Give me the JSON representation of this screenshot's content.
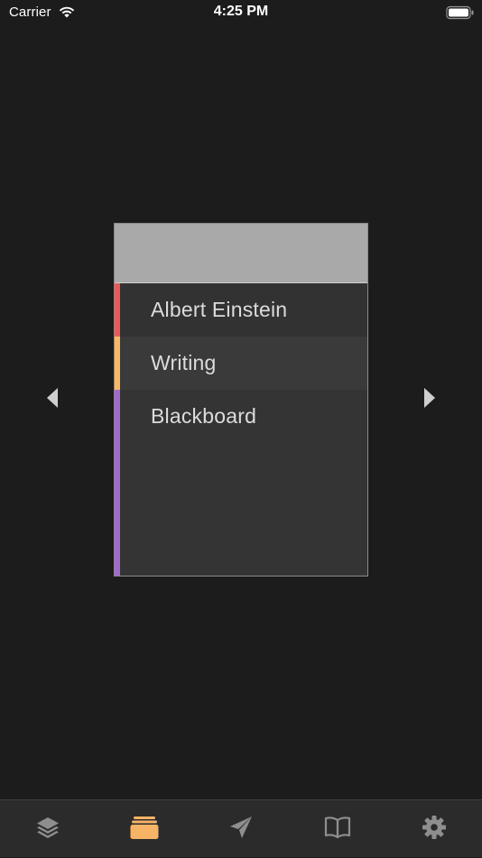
{
  "status_bar": {
    "carrier": "Carrier",
    "time": "4:25 PM"
  },
  "colors": {
    "background": "#1c1c1c",
    "tab_active": "#f7b366",
    "tab_inactive": "#8e8e8e",
    "stripe_red": "#e65a5a",
    "stripe_orange": "#f5b866",
    "stripe_purple": "#a06cc8"
  },
  "navigation": {
    "prev_icon": "triangle-left-icon",
    "next_icon": "triangle-right-icon"
  },
  "card": {
    "items": [
      {
        "label": "Albert Einstein",
        "stripe_color": "#e65a5a"
      },
      {
        "label": "Writing",
        "stripe_color": "#f5b866"
      },
      {
        "label": "Blackboard",
        "stripe_color": "#a06cc8"
      }
    ]
  },
  "tab_bar": {
    "tabs": [
      {
        "icon": "layers-icon",
        "active": false
      },
      {
        "icon": "folder-icon",
        "active": true
      },
      {
        "icon": "paper-plane-icon",
        "active": false
      },
      {
        "icon": "book-icon",
        "active": false
      },
      {
        "icon": "gear-icon",
        "active": false
      }
    ]
  }
}
